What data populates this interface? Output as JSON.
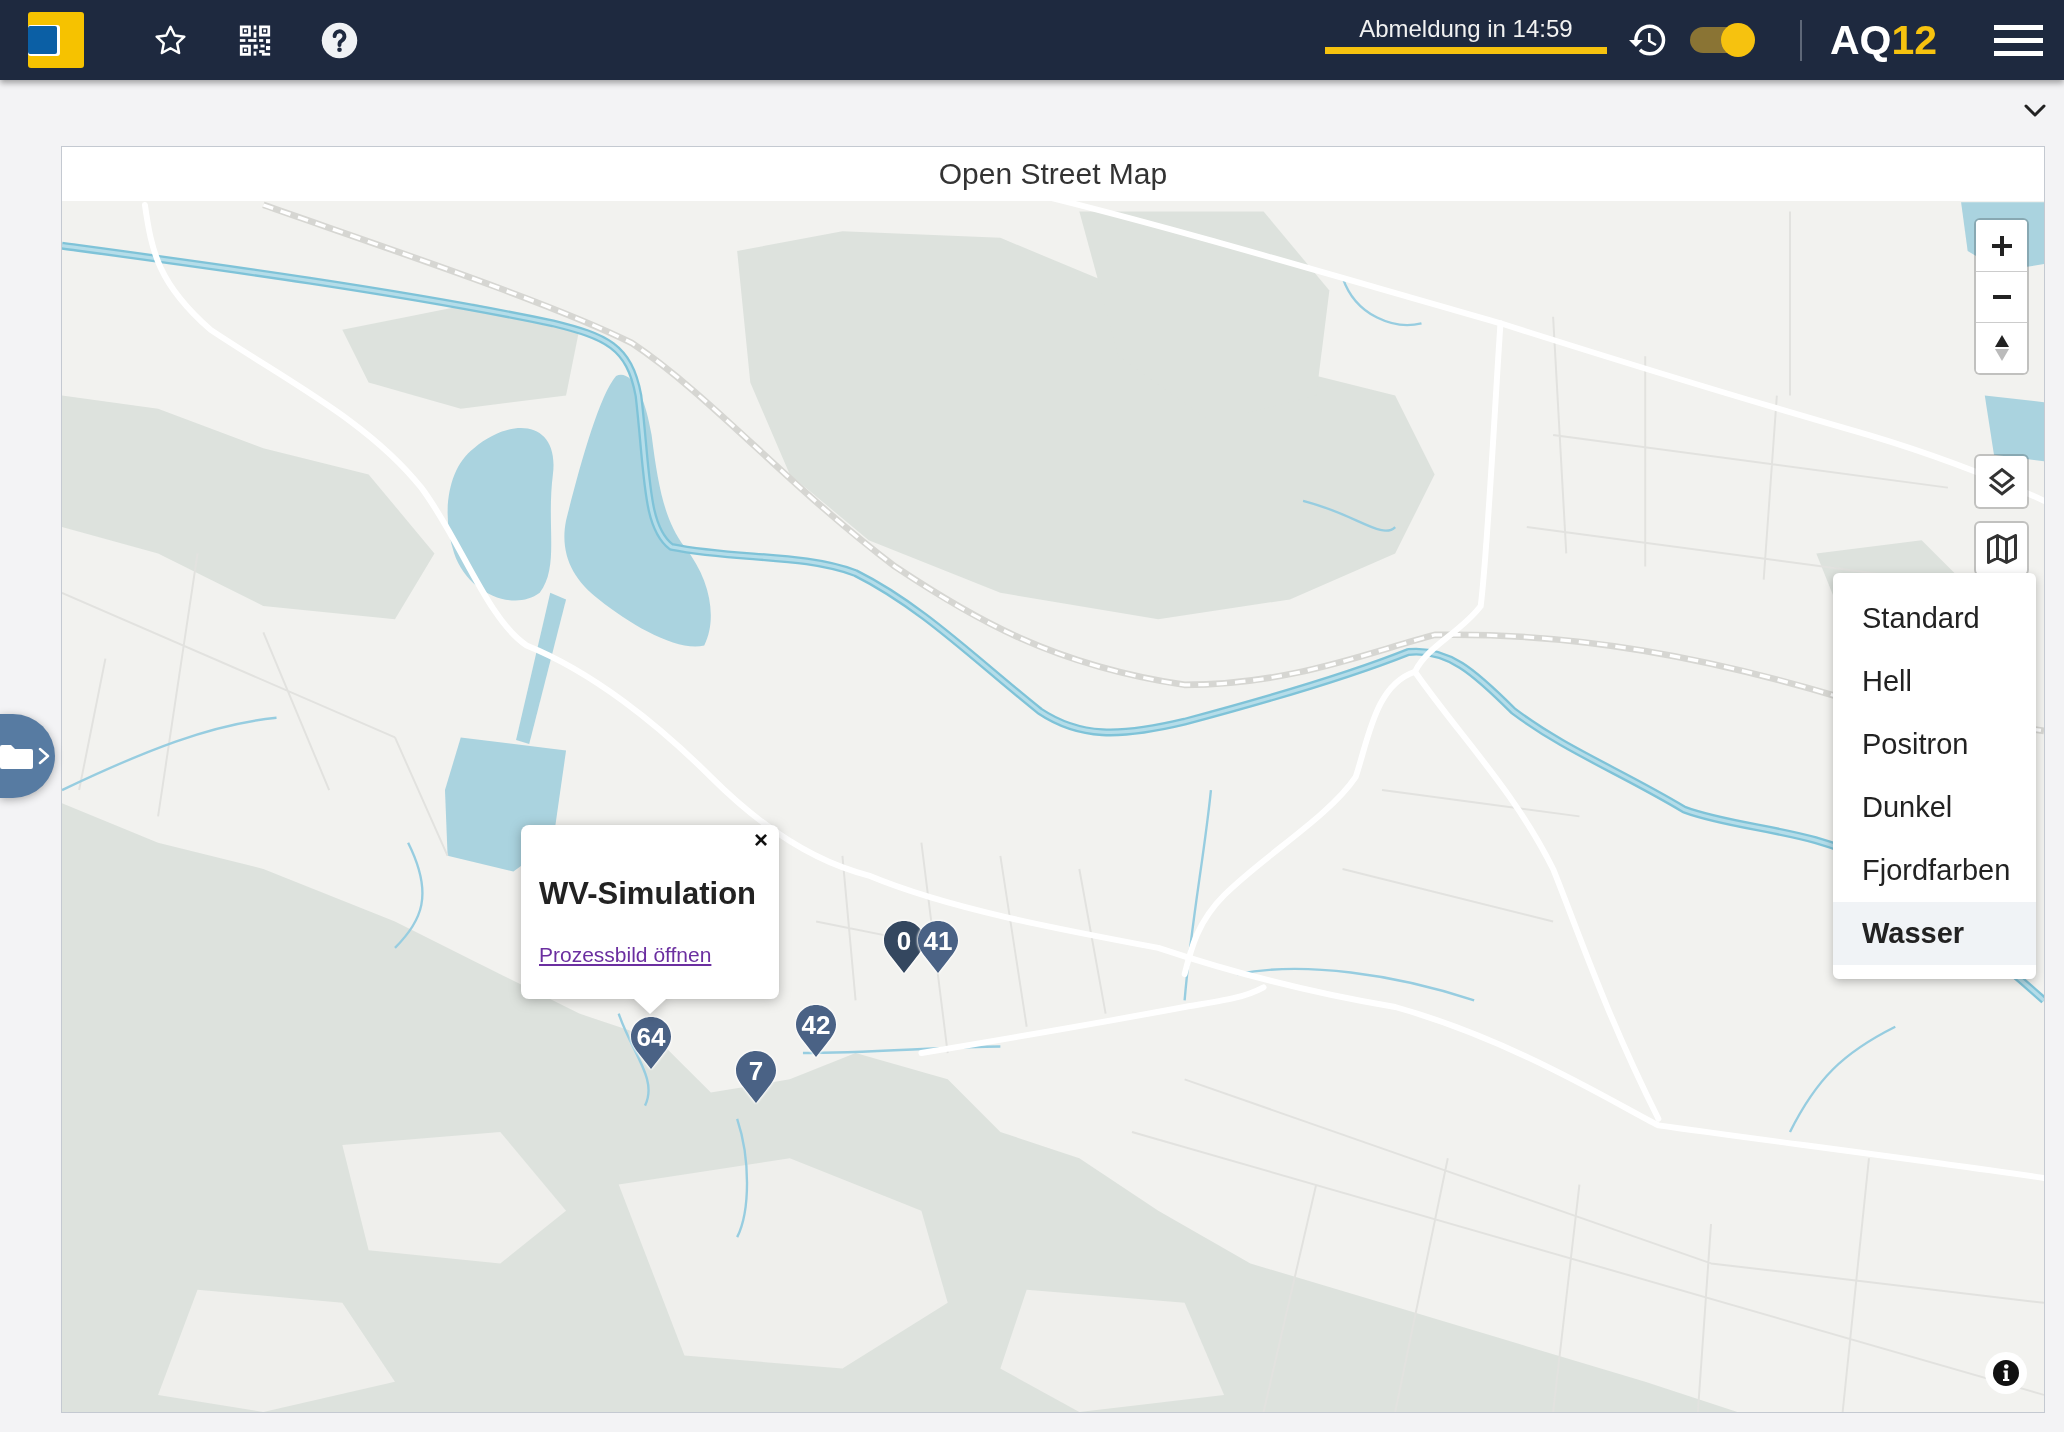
{
  "top_bar": {
    "session": {
      "label": "Abmeldung in 14:59",
      "level": 1
    },
    "toggle": {
      "on": true
    },
    "brand": {
      "letters": "AQ",
      "digits": "12"
    }
  },
  "card": {
    "title": "Open Street Map"
  },
  "map": {
    "markers": [
      {
        "label": "0",
        "color": "#34475f"
      },
      {
        "label": "41",
        "color": "#4a6285"
      },
      {
        "label": "42",
        "color": "#4a6285"
      },
      {
        "label": "64",
        "color": "#4a6285"
      },
      {
        "label": "7",
        "color": "#4a6285"
      }
    ],
    "popup": {
      "close": "×",
      "title": "WV-Simulation",
      "link": "Prozessbild öffnen"
    },
    "layer_menu": {
      "items": [
        {
          "label": "Standard",
          "selected": false
        },
        {
          "label": "Hell",
          "selected": false
        },
        {
          "label": "Positron",
          "selected": false
        },
        {
          "label": "Dunkel",
          "selected": false
        },
        {
          "label": "Fjordfarben",
          "selected": false
        },
        {
          "label": "Wasser",
          "selected": true
        }
      ]
    }
  }
}
